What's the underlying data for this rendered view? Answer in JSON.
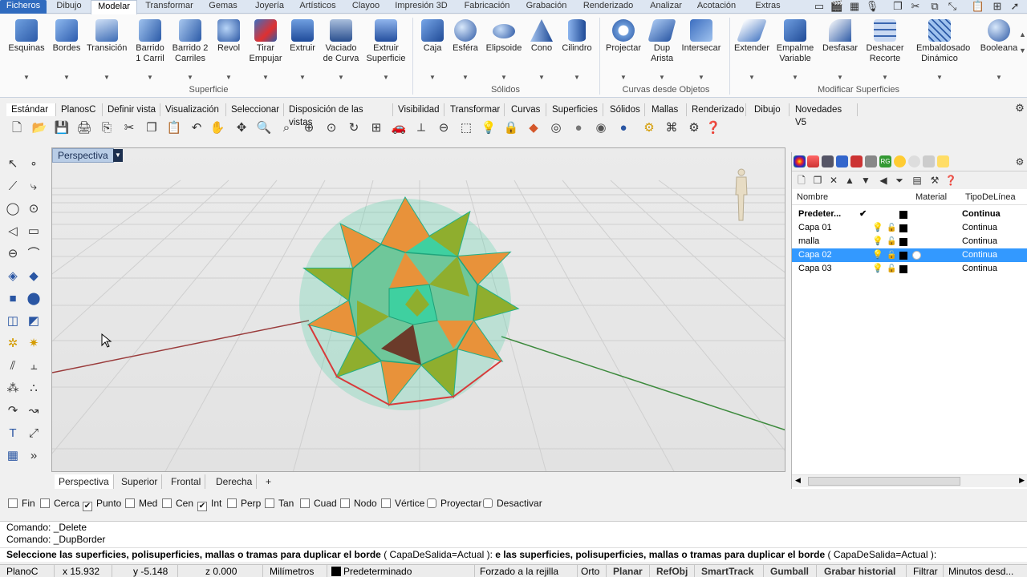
{
  "menu": {
    "tabs": [
      "Ficheros",
      "Dibujo",
      "Modelar",
      "Transformar",
      "Gemas",
      "Joyería",
      "Artísticos",
      "Clayoo",
      "Impresión 3D",
      "Fabricación",
      "Grabación",
      "Renderizado",
      "Analizar",
      "Acotación",
      "Extras"
    ],
    "active": "Modelar"
  },
  "ribbon": {
    "groups": [
      {
        "name": "Superficie",
        "buttons": [
          "Esquinas",
          "Bordes",
          "Transición",
          "Barrido\n1 Carril",
          "Barrido 2\nCarriles",
          "Revol",
          "Tirar\nEmpujar",
          "Extruir",
          "Vaciado\nde Curva",
          "Extruir\nSuperficie"
        ]
      },
      {
        "name": "Sólidos",
        "buttons": [
          "Caja",
          "Esféra",
          "Elipsoide",
          "Cono",
          "Cilindro"
        ]
      },
      {
        "name": "Curvas desde Objetos",
        "buttons": [
          "Projectar",
          "Dup\nArista",
          "Intersecar"
        ]
      },
      {
        "name": "Modificar Superficies",
        "buttons": [
          "Extender",
          "Empalme\nVariable",
          "Desfasar",
          "Deshacer\nRecorte",
          "Embaldosado\nDinámico",
          "Booleana"
        ]
      }
    ]
  },
  "toolbar_tabs": [
    "Estándar",
    "PlanosC",
    "Definir vista",
    "Visualización",
    "Seleccionar",
    "Disposición de las vistas",
    "Visibilidad",
    "Transformar",
    "Curvas",
    "Superficies",
    "Sólidos",
    "Mallas",
    "Renderizado",
    "Dibujo",
    "Novedades V5"
  ],
  "viewport": {
    "label": "Perspectiva",
    "tabs": [
      "Perspectiva",
      "Superior",
      "Frontal",
      "Derecha"
    ],
    "add_tab": "+"
  },
  "layers": {
    "columns": {
      "name": "Nombre",
      "material": "Material",
      "linetype": "TipoDeLínea"
    },
    "rows": [
      {
        "name": "Predeter...",
        "current": "✔",
        "linetype": "Continua",
        "selected": false
      },
      {
        "name": "Capa 01",
        "current": "",
        "linetype": "Continua",
        "selected": false
      },
      {
        "name": "malla",
        "current": "",
        "linetype": "Continua",
        "selected": false
      },
      {
        "name": "Capa 02",
        "current": "",
        "linetype": "Continua",
        "selected": true
      },
      {
        "name": "Capa 03",
        "current": "",
        "linetype": "Continua",
        "selected": false
      }
    ]
  },
  "osnap": [
    {
      "label": "Fin",
      "checked": false
    },
    {
      "label": "Cerca",
      "checked": false
    },
    {
      "label": "Punto",
      "checked": true
    },
    {
      "label": "Med",
      "checked": false
    },
    {
      "label": "Cen",
      "checked": false
    },
    {
      "label": "Int",
      "checked": true
    },
    {
      "label": "Perp",
      "checked": false
    },
    {
      "label": "Tan",
      "checked": false
    },
    {
      "label": "Cuad",
      "checked": false
    },
    {
      "label": "Nodo",
      "checked": false
    },
    {
      "label": "Vértice",
      "checked": false
    },
    {
      "label": "Proyectar",
      "checked": false
    },
    {
      "label": "Desactivar",
      "checked": false
    }
  ],
  "command": {
    "history": [
      "Comando: _Delete",
      "Comando: _DupBorder"
    ],
    "prompt_bold": "Seleccione las superficies, polisuperficies, mallas o tramas para duplicar el borde",
    "prompt_option": "( CapaDeSalida=Actual ):",
    "prompt_repeat": "e las superficies, polisuperficies, mallas o tramas para duplicar el borde",
    "prompt_option2": "( CapaDeSalida=Actual ):"
  },
  "status": {
    "plane": "PlanoC",
    "x": "x 15.932",
    "y": "y -5.148",
    "z": "z 0.000",
    "units": "Milímetros",
    "layer": "Predeterminado",
    "grid_snap": "Forzado a la rejilla",
    "ortho": "Orto",
    "planar": "Planar",
    "refobj": "RefObj",
    "smarttrack": "SmartTrack",
    "gumball": "Gumball",
    "history": "Grabar historial",
    "filter": "Filtrar",
    "minutes": "Minutos desd..."
  },
  "colors": {
    "file_tab": "#2f6bbf",
    "selection": "#3399ff",
    "vp_label": "#b9cde6",
    "obj_green": "#3fd0a0",
    "obj_orange": "#e8923a",
    "obj_olive": "#8fae2e"
  }
}
